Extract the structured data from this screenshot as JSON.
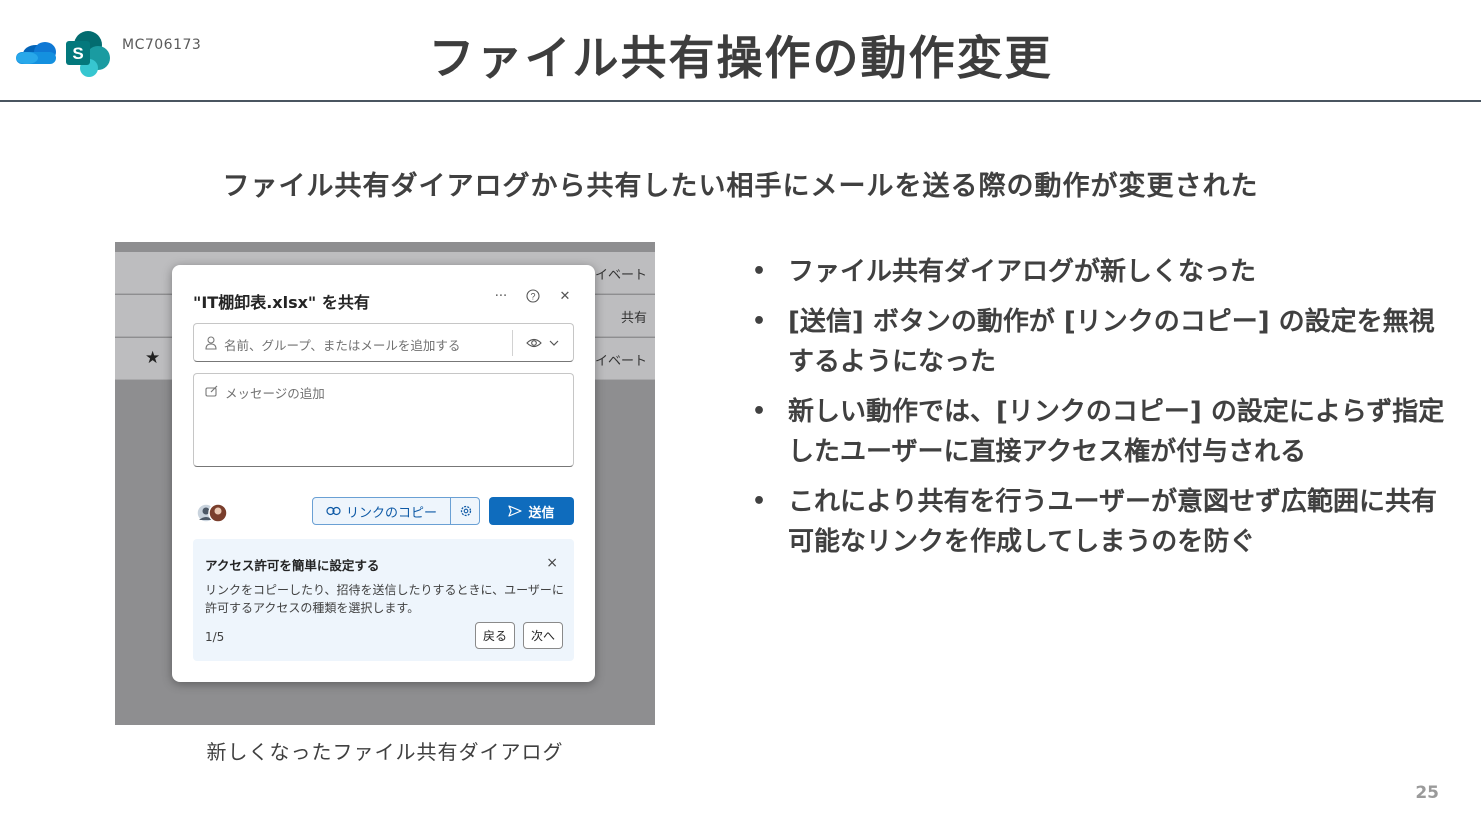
{
  "header": {
    "mc_id": "MC706173",
    "title": "ファイル共有操作の動作変更"
  },
  "subtitle": "ファイル共有ダイアログから共有したい相手にメールを送る際の動作が変更された",
  "screenshot": {
    "background_rows": [
      {
        "text": "ライベート",
        "star": false
      },
      {
        "text": "共有",
        "star": false
      },
      {
        "text": "ライベート",
        "star": true
      }
    ],
    "dialog": {
      "title": "\"IT棚卸表.xlsx\" を共有",
      "more_glyph": "···",
      "help_glyph": "?",
      "close_glyph": "✕",
      "people_placeholder": "名前、グループ、またはメールを追加する",
      "message_placeholder": "メッセージの追加",
      "copy_link_label": "リンクのコピー",
      "send_label": "送信",
      "tip": {
        "title": "アクセス許可を簡単に設定する",
        "body": "リンクをコピーしたり、招待を送信したりするときに、ユーザーに許可するアクセスの種類を選択します。",
        "count": "1/5",
        "back_label": "戻る",
        "next_label": "次へ",
        "close_glyph": "×"
      }
    },
    "caption": "新しくなったファイル共有ダイアログ"
  },
  "bullets": [
    "ファイル共有ダイアログが新しくなった",
    "[送信] ボタンの動作が [リンクのコピー] の設定を無視するようになった",
    "新しい動作では、[リンクのコピー] の設定によらず指定したユーザーに直接アクセス権が付与される",
    "これにより共有を行うユーザーが意図せず広範囲に共有可能なリンクを作成してしまうのを防ぐ"
  ],
  "bullet_glyph": "•",
  "page_number": "25",
  "colors": {
    "onedrive_blue": "#0f78d4",
    "sharepoint_teal": "#038387",
    "primary_button": "#0f6cbd",
    "header_rule": "#4a5560"
  }
}
